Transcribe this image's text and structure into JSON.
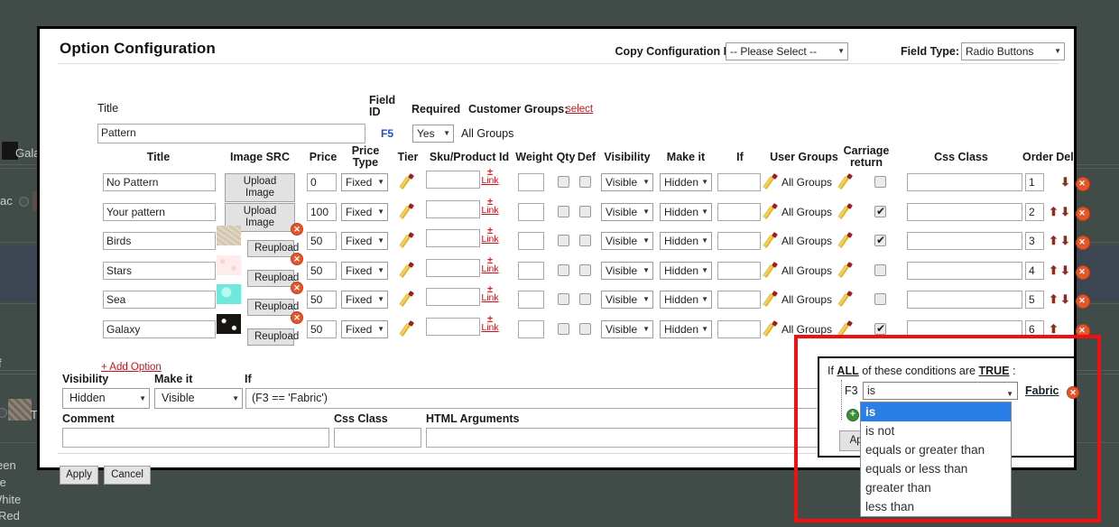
{
  "modal": {
    "title": "Option Configuration",
    "copy_config_label": "Copy Configuration From:",
    "copy_config_value": "-- Please Select --",
    "field_type_label": "Field Type:",
    "field_type_value": "Radio Buttons"
  },
  "header_form": {
    "title_label": "Title",
    "title_value": "Pattern",
    "field_id_label": "Field ID",
    "field_id_value": "F5",
    "required_label": "Required",
    "required_value": "Yes",
    "customer_groups_label": "Customer Groups:",
    "customer_groups_select": "select",
    "customer_groups_value": "All Groups"
  },
  "table": {
    "columns": [
      "Title",
      "Image SRC",
      "Price",
      "Price Type",
      "Tier",
      "Sku/Product Id",
      "Weight",
      "Qty",
      "Def",
      "Visibility",
      "Make it",
      "If",
      "User Groups",
      "Carriage return",
      "Css Class",
      "Order",
      "Del"
    ],
    "link_plus": "+",
    "link_label": "Link",
    "upload_label": "Upload Image",
    "reupload_label": "Reupload",
    "rows": [
      {
        "title": "No Pattern",
        "has_image": false,
        "image_color": "",
        "upload": "Upload Image",
        "price": "0",
        "price_type": "Fixed",
        "sku": "",
        "weight": "",
        "qty": false,
        "def": false,
        "visibility": "Visible",
        "make_it": "Hidden",
        "if": "",
        "user_groups": "All Groups",
        "carriage": false,
        "css_class": "",
        "order": "1",
        "up": false,
        "down": true
      },
      {
        "title": "Your pattern",
        "has_image": false,
        "image_color": "",
        "upload": "Upload Image",
        "price": "100",
        "price_type": "Fixed",
        "sku": "",
        "weight": "",
        "qty": false,
        "def": false,
        "visibility": "Visible",
        "make_it": "Hidden",
        "if": "",
        "user_groups": "All Groups",
        "carriage": true,
        "css_class": "",
        "order": "2",
        "up": true,
        "down": true
      },
      {
        "title": "Birds",
        "has_image": true,
        "image_color": "#d8cfc0",
        "upload": "Reupload",
        "price": "50",
        "price_type": "Fixed",
        "sku": "",
        "weight": "",
        "qty": false,
        "def": false,
        "visibility": "Visible",
        "make_it": "Hidden",
        "if": "",
        "user_groups": "All Groups",
        "carriage": true,
        "css_class": "",
        "order": "3",
        "up": true,
        "down": true
      },
      {
        "title": "Stars",
        "has_image": true,
        "image_color": "#fbe3e2",
        "upload": "Reupload",
        "price": "50",
        "price_type": "Fixed",
        "sku": "",
        "weight": "",
        "qty": false,
        "def": false,
        "visibility": "Visible",
        "make_it": "Hidden",
        "if": "",
        "user_groups": "All Groups",
        "carriage": false,
        "css_class": "",
        "order": "4",
        "up": true,
        "down": true
      },
      {
        "title": "Sea",
        "has_image": true,
        "image_color": "#7ff0e0",
        "upload": "Reupload",
        "price": "50",
        "price_type": "Fixed",
        "sku": "",
        "weight": "",
        "qty": false,
        "def": false,
        "visibility": "Visible",
        "make_it": "Hidden",
        "if": "",
        "user_groups": "All Groups",
        "carriage": false,
        "css_class": "",
        "order": "5",
        "up": true,
        "down": true
      },
      {
        "title": "Galaxy",
        "has_image": true,
        "image_color": "#14120f",
        "upload": "Reupload",
        "price": "50",
        "price_type": "Fixed",
        "sku": "",
        "weight": "",
        "qty": false,
        "def": false,
        "visibility": "Visible",
        "make_it": "Hidden",
        "if": "",
        "user_groups": "All Groups",
        "carriage": true,
        "css_class": "",
        "order": "6",
        "up": true,
        "down": false
      }
    ]
  },
  "bottom": {
    "add_option": "+ Add Option",
    "visibility_label": "Visibility",
    "visibility_value": "Hidden",
    "make_it_label": "Make it",
    "make_it_value": "Visible",
    "if_label": "If",
    "if_value": "(F3 == 'Fabric')",
    "comment_label": "Comment",
    "comment_value": "",
    "css_class_label": "Css Class",
    "css_class_value": "",
    "html_args_label": "HTML Arguments",
    "html_args_value": "",
    "apply_label": "Apply",
    "cancel_label": "Cancel"
  },
  "condition_popup": {
    "intro_prefix": "If ",
    "intro_all": "ALL",
    "intro_mid": " of these conditions are ",
    "intro_true": "TRUE",
    "intro_suffix": " :",
    "field_id": "F3",
    "operator_value": "is",
    "value_label": "Fabric",
    "apply_label": "Apply",
    "options": [
      "is",
      "is not",
      "equals or greater than",
      "equals or less than",
      "greater than",
      "less than"
    ],
    "selected_option": "is"
  },
  "background": {
    "galaxy_label": "Galaxy",
    "fabric_label": "ac",
    "ty_label": "Ty",
    "color_list": [
      "een",
      "te",
      "White",
      "Red"
    ]
  },
  "colors": {
    "highlight_box": "#f20f0f",
    "dropdown_selected": "#2a7fe6",
    "link_red": "#c4161c",
    "field_id_blue": "#1b4fd6",
    "page_backdrop": "#414b48"
  }
}
